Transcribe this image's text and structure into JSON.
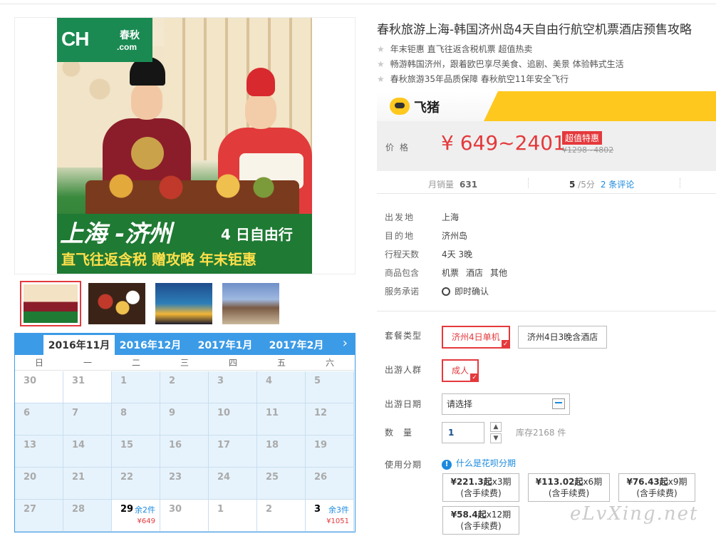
{
  "product": {
    "title": "春秋旅游上海-韩国济州岛4天自由行航空机票酒店预售攻略",
    "highlights": [
      "年末钜惠 直飞往返含税机票 超值热卖",
      "畅游韩国济州，跟着欧巴享尽美食、追剧、美景 体验韩式生活",
      "春秋旅游35年品质保障 春秋航空11年安全飞行"
    ]
  },
  "poster": {
    "logo_text": "CH",
    "logo_cn": "春秋",
    "logo_com": ".com",
    "route": "上海 -济州",
    "days": "4 日自由行",
    "slogan": "直飞往返含税 赠攻略 年末钜惠"
  },
  "thumbnails": [
    "thumb-poster",
    "thumb-food",
    "thumb-night",
    "thumb-village"
  ],
  "calendar": {
    "months": [
      "2016年11月",
      "2016年12月",
      "2017年1月",
      "2017年2月"
    ],
    "active_month": 0,
    "next_icon": "chevron-right-icon",
    "weekdays": [
      "日",
      "一",
      "二",
      "三",
      "四",
      "五",
      "六"
    ],
    "weeks": [
      [
        {
          "d": "30",
          "w": true
        },
        {
          "d": "31",
          "w": true
        },
        {
          "d": "1"
        },
        {
          "d": "2"
        },
        {
          "d": "3"
        },
        {
          "d": "4"
        },
        {
          "d": "5"
        }
      ],
      [
        {
          "d": "6"
        },
        {
          "d": "7"
        },
        {
          "d": "8"
        },
        {
          "d": "9"
        },
        {
          "d": "10"
        },
        {
          "d": "11"
        },
        {
          "d": "12"
        }
      ],
      [
        {
          "d": "13"
        },
        {
          "d": "14"
        },
        {
          "d": "15"
        },
        {
          "d": "16"
        },
        {
          "d": "17"
        },
        {
          "d": "18"
        },
        {
          "d": "19"
        }
      ],
      [
        {
          "d": "20"
        },
        {
          "d": "21"
        },
        {
          "d": "22"
        },
        {
          "d": "23"
        },
        {
          "d": "24"
        },
        {
          "d": "25"
        },
        {
          "d": "26"
        }
      ],
      [
        {
          "d": "27"
        },
        {
          "d": "28"
        },
        {
          "d": "29",
          "w": true,
          "avail": true,
          "rem": "余2件",
          "price": "¥649"
        },
        {
          "d": "30",
          "w": true
        },
        {
          "d": "1",
          "w": true
        },
        {
          "d": "2",
          "w": true
        },
        {
          "d": "3",
          "w": true,
          "avail": true,
          "rem": "余3件",
          "price": "¥1051"
        }
      ]
    ]
  },
  "fliggy": {
    "brand": "飞猪"
  },
  "price": {
    "label": "价格",
    "range": "¥ 649~2401",
    "badge": "超值特惠",
    "original": "¥1298~4802"
  },
  "stats": {
    "sales_label": "月销量",
    "sales_value": "631",
    "rating_value": "5",
    "rating_suffix": " /5分",
    "reviews": "2 条评论"
  },
  "info": [
    {
      "label": "出发地",
      "value": "上海"
    },
    {
      "label": "目的地",
      "value": "济州岛"
    },
    {
      "label": "行程天数",
      "value": "4天 3晚"
    },
    {
      "label": "商品包含",
      "values": [
        "机票",
        "酒店",
        "其他"
      ]
    },
    {
      "label": "服务承诺",
      "value": "即时确认",
      "icon": "check-circle-icon"
    }
  ],
  "options": {
    "package_label": "套餐类型",
    "packages": [
      "济州4日单机",
      "济州4日3晚含酒店"
    ],
    "selected_package": 0,
    "people_label": "出游人群",
    "people": [
      "成人"
    ],
    "date_label": "出游日期",
    "date_placeholder": "请选择",
    "qty_label": "数量",
    "qty_value": "1",
    "stock": "库存2168 件",
    "installment_label": "使用分期",
    "installment_link": "什么是花呗分期",
    "installments": [
      {
        "main": "¥221.3起",
        "period": "x3期",
        "note": "(含手续费)"
      },
      {
        "main": "¥113.02起",
        "period": "x6期",
        "note": "(含手续费)"
      },
      {
        "main": "¥76.43起",
        "period": "x9期",
        "note": "(含手续费)"
      },
      {
        "main": "¥58.4起",
        "period": "x12期",
        "note": "(含手续费)"
      }
    ]
  },
  "watermark": "eLvXing.net",
  "colors": {
    "accent": "#e4393c",
    "link": "#1a8adf",
    "calendar": "#3c9be6",
    "fliggy": "#ffc81e"
  }
}
